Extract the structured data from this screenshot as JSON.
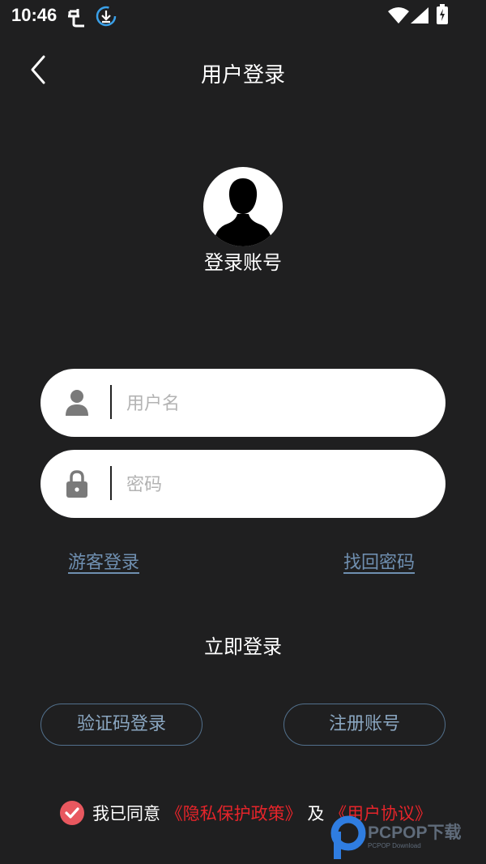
{
  "status_bar": {
    "time": "10:46"
  },
  "header": {
    "title": "用户登录"
  },
  "profile": {
    "label": "登录账号"
  },
  "form": {
    "username_placeholder": "用户名",
    "username_value": "",
    "password_placeholder": "密码",
    "password_value": ""
  },
  "links": {
    "guest_login": "游客登录",
    "recover_password": "找回密码"
  },
  "actions": {
    "login_now": "立即登录",
    "sms_login": "验证码登录",
    "register": "注册账号"
  },
  "agreement": {
    "checked": true,
    "prefix": "我已同意",
    "privacy_policy": "《隐私保护政策》",
    "conjunction": "及",
    "user_agreement": "《用户协议》"
  },
  "watermark": {
    "brand": "PCPOP下载",
    "sub": "PCPOP Download"
  },
  "colors": {
    "background": "#1f1f20",
    "link": "#6f8fb0",
    "button_border": "#52708c",
    "agreement_red": "#e6242a",
    "check_red": "#e8585f"
  }
}
